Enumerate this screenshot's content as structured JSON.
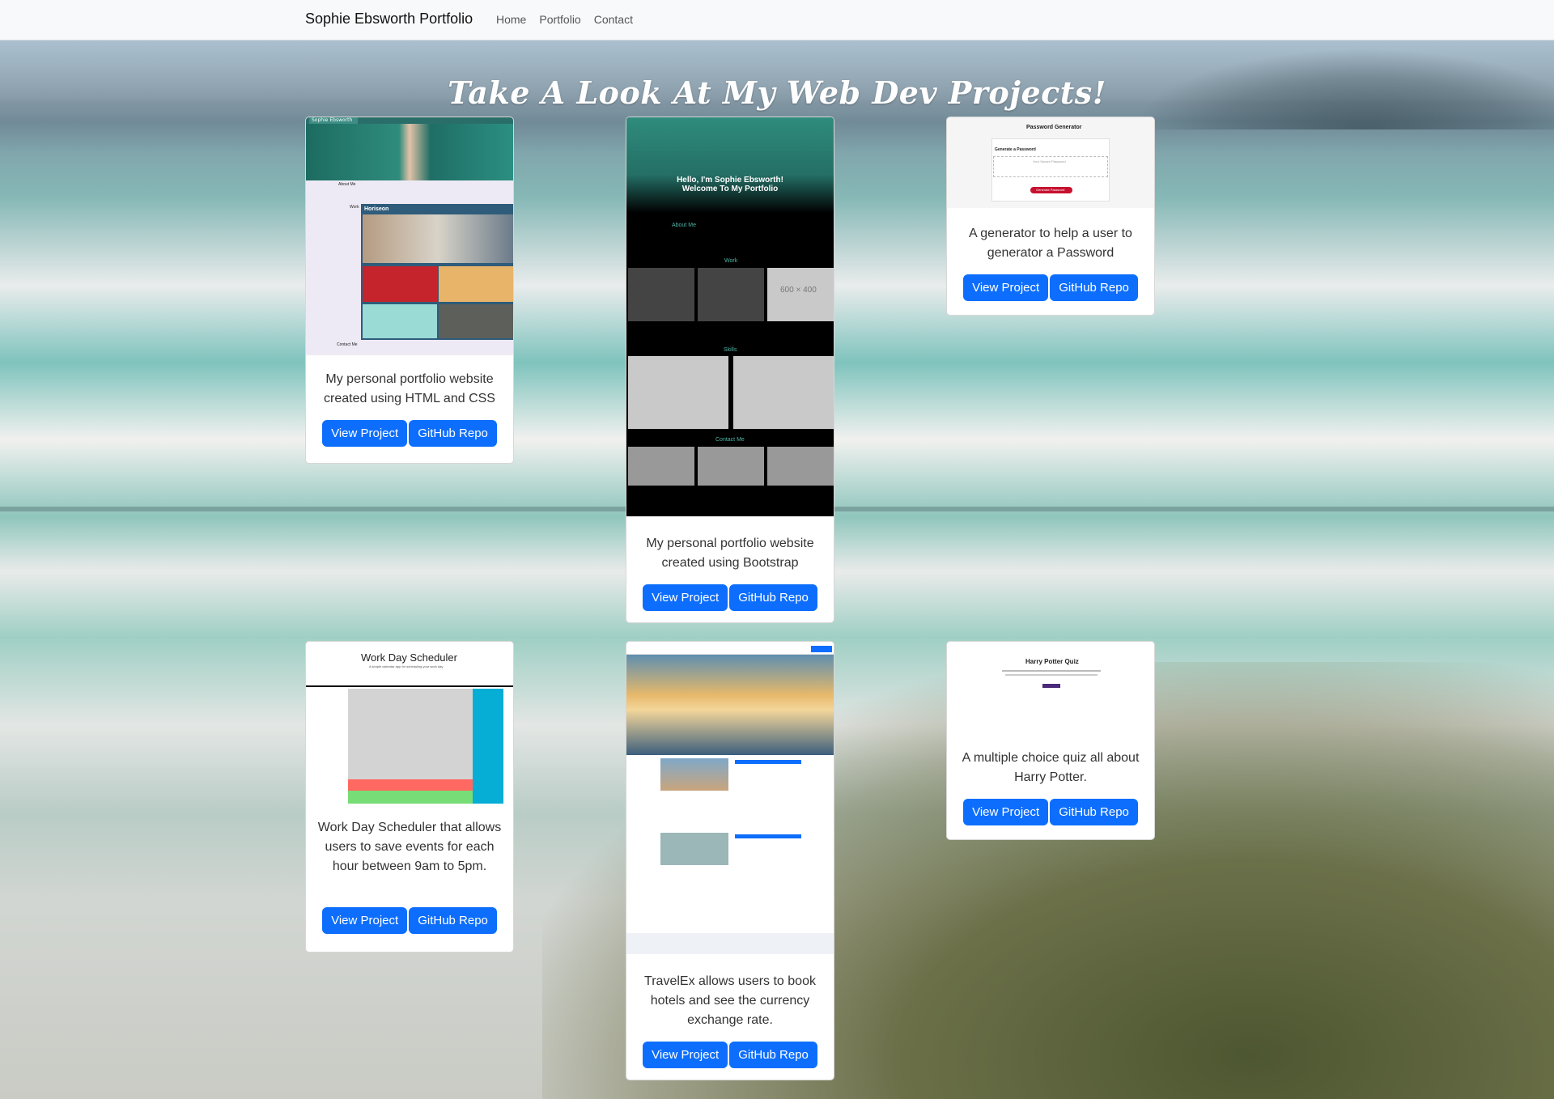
{
  "navbar": {
    "brand": "Sophie Ebsworth Portfolio",
    "links": [
      "Home",
      "Portfolio",
      "Contact"
    ]
  },
  "page": {
    "title": "Take A Look At My Web Dev Projects!"
  },
  "projects": [
    {
      "description": "My personal portfolio website created using HTML and CSS",
      "view_label": "View Project",
      "repo_label": "GitHub Repo",
      "thumb": {
        "brand": "Sophie Ebsworth",
        "section": "Horiseon",
        "labels": [
          "About Me",
          "Work",
          "Contact Me"
        ]
      }
    },
    {
      "description": "My personal portfolio website created using Bootstrap",
      "view_label": "View Project",
      "repo_label": "GitHub Repo",
      "thumb": {
        "hero_line1": "Hello, I'm Sophie Ebsworth!",
        "hero_line2": "Welcome To My Portfolio",
        "about": "About Me",
        "work": "Work",
        "skills": "Skills",
        "contact": "Contact Me",
        "placeholder": "600 × 400"
      }
    },
    {
      "description": "A generator to help a user to generator a Password",
      "view_label": "View Project",
      "repo_label": "GitHub Repo",
      "thumb": {
        "title": "Password Generator",
        "subtitle": "Generate a Password",
        "placeholder": "Your Secure Password",
        "button": "Generate Password"
      }
    },
    {
      "description": "Work Day Scheduler that allows users to save events for each hour between 9am to 5pm.",
      "view_label": "View Project",
      "repo_label": "GitHub Repo",
      "thumb": {
        "title": "Work Day Scheduler",
        "subtitle": "A simple calendar app for scheduling your work day"
      }
    },
    {
      "description": "TravelEx allows users to book hotels and see the currency exchange rate.",
      "view_label": "View Project",
      "repo_label": "GitHub Repo",
      "thumb": {}
    },
    {
      "description": "A multiple choice quiz all about Harry Potter.",
      "view_label": "View Project",
      "repo_label": "GitHub Repo",
      "thumb": {
        "title": "Harry Potter Quiz"
      }
    }
  ],
  "colors": {
    "primary_button": "#0d6efd",
    "navbar_bg": "#f8f9fa",
    "card_bg": "#ffffff"
  }
}
